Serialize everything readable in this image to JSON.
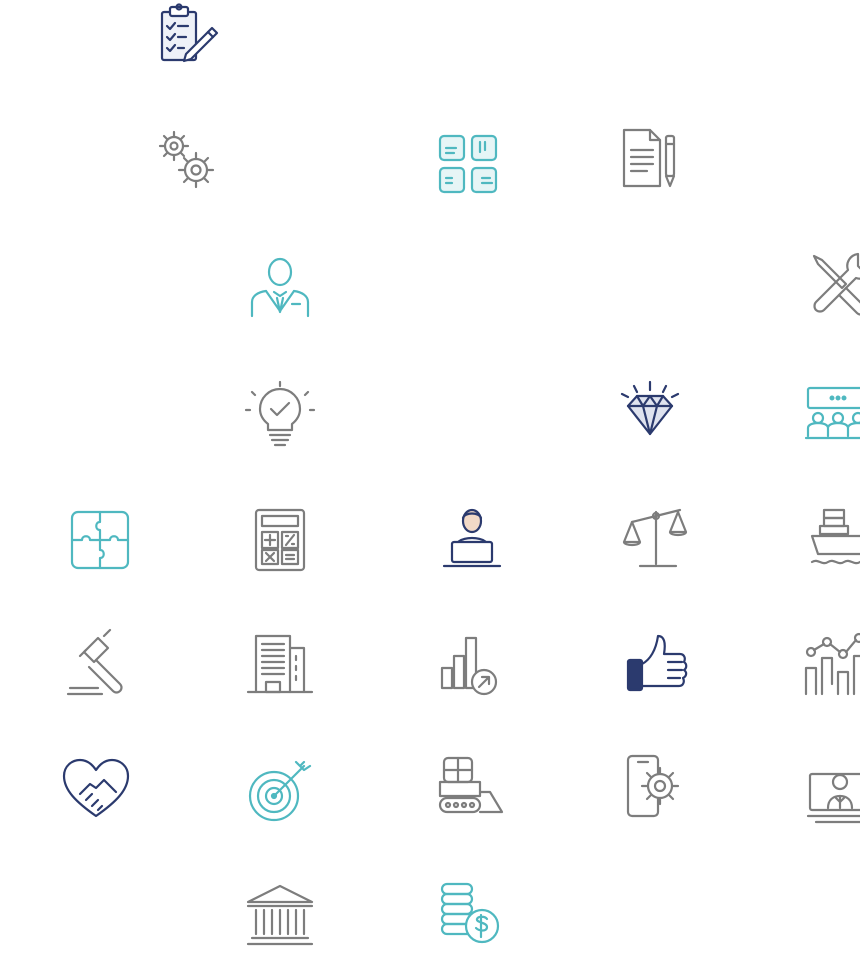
{
  "colors": {
    "navy": "#2b3a6e",
    "teal": "#4fb8c0",
    "gray": "#7d7d7d",
    "light_gray": "#9a9a9a"
  },
  "icons": [
    {
      "name": "clipboard-checklist-pen-icon",
      "color": "navy"
    },
    {
      "name": "gears-icon",
      "color": "gray"
    },
    {
      "name": "hands-together-icon",
      "color": "teal"
    },
    {
      "name": "document-pen-icon",
      "color": "gray"
    },
    {
      "name": "businessman-icon",
      "color": "teal"
    },
    {
      "name": "wrench-screwdriver-icon",
      "color": "gray"
    },
    {
      "name": "lightbulb-check-icon",
      "color": "gray"
    },
    {
      "name": "diamond-icon",
      "color": "navy"
    },
    {
      "name": "conference-audience-icon",
      "color": "teal"
    },
    {
      "name": "puzzle-icon",
      "color": "teal"
    },
    {
      "name": "calculator-icon",
      "color": "gray"
    },
    {
      "name": "person-laptop-icon",
      "color": "navy"
    },
    {
      "name": "balance-scale-icon",
      "color": "gray"
    },
    {
      "name": "cargo-ship-icon",
      "color": "gray"
    },
    {
      "name": "gavel-icon",
      "color": "gray"
    },
    {
      "name": "office-building-icon",
      "color": "gray"
    },
    {
      "name": "bar-chart-growth-icon",
      "color": "gray"
    },
    {
      "name": "thumbs-up-icon",
      "color": "navy"
    },
    {
      "name": "bar-line-chart-icon",
      "color": "gray"
    },
    {
      "name": "handshake-heart-icon",
      "color": "navy"
    },
    {
      "name": "target-arrow-icon",
      "color": "teal"
    },
    {
      "name": "bulldozer-icon",
      "color": "gray"
    },
    {
      "name": "mobile-gear-icon",
      "color": "gray"
    },
    {
      "name": "presenter-screen-icon",
      "color": "gray"
    },
    {
      "name": "bank-building-icon",
      "color": "gray"
    },
    {
      "name": "coins-dollar-icon",
      "color": "teal"
    }
  ]
}
